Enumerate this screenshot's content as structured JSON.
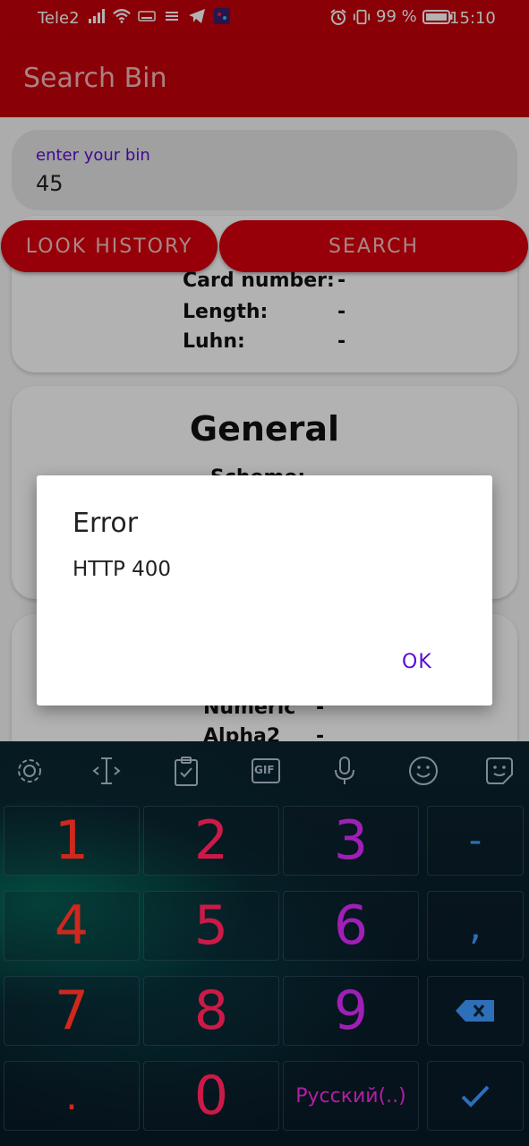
{
  "status_bar": {
    "carrier": "Tele2",
    "battery": "99 %",
    "time": "15:10"
  },
  "app_bar": {
    "title": "Search Bin"
  },
  "search": {
    "label": "enter your bin",
    "value": "45",
    "history_button": "LOOK HISTORY",
    "search_button": "SEARCH"
  },
  "card_number": {
    "rows": [
      {
        "label": "Card number:",
        "value": "-"
      },
      {
        "label": "Length:",
        "value": "-"
      },
      {
        "label": "Luhn:",
        "value": "-"
      }
    ]
  },
  "general": {
    "title": "General",
    "rows": [
      {
        "label": "Scheme:",
        "value": "-"
      }
    ]
  },
  "country": {
    "rows": [
      {
        "label": "Numeric",
        "value": "-"
      },
      {
        "label": "Alpha2",
        "value": "-"
      }
    ]
  },
  "dialog": {
    "title": "Error",
    "message": "HTTP 400",
    "ok": "OK"
  },
  "keyboard": {
    "toolbar": [
      "gear-icon",
      "cursor-move-icon",
      "clipboard-icon",
      "gif-icon",
      "microphone-icon",
      "emoji-icon",
      "sticker-icon"
    ],
    "gif_label": "GIF",
    "keys": {
      "k1": "1",
      "k2": "2",
      "k3": "3",
      "minus": "-",
      "k4": "4",
      "k5": "5",
      "k6": "6",
      "comma": ",",
      "k7": "7",
      "k8": "8",
      "k9": "9",
      "backspace": "backspace-icon",
      "dot": ".",
      "k0": "0",
      "language": "Русский(..)",
      "enter": "check-icon"
    }
  }
}
